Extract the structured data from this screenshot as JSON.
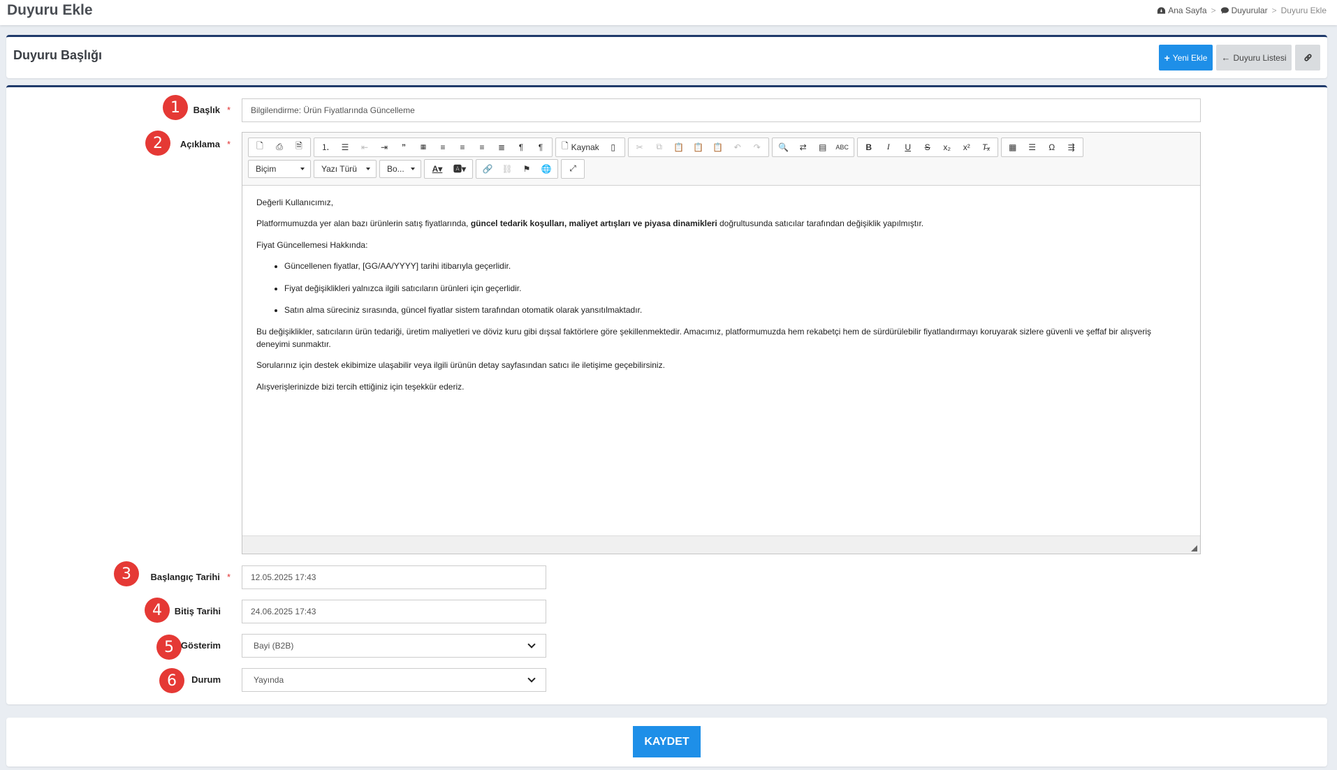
{
  "page": {
    "title": "Duyuru Ekle"
  },
  "breadcrumb": {
    "home": "Ana Sayfa",
    "announcements": "Duyurular",
    "current": "Duyuru Ekle",
    "separator": ">"
  },
  "header": {
    "title": "Duyuru Başlığı",
    "add_new": "Yeni Ekle",
    "list": "Duyuru Listesi"
  },
  "form": {
    "title_label": "Başlık",
    "title_value": "Bilgilendirme: Ürün Fiyatlarında Güncelleme",
    "desc_label": "Açıklama",
    "start_label": "Başlangıç Tarihi",
    "start_value": "12.05.2025 17:43",
    "end_label": "Bitiş Tarihi",
    "end_value": "24.06.2025 17:43",
    "display_label": "Gösterim",
    "display_value": "Bayi (B2B)",
    "status_label": "Durum",
    "status_value": "Yayında",
    "required_mark": "*"
  },
  "markers": [
    "1",
    "2",
    "3",
    "4",
    "5",
    "6"
  ],
  "editor": {
    "source_label": "Kaynak",
    "format_combo": "Biçim",
    "font_combo": "Yazı Türü",
    "size_combo": "Bo...",
    "content": {
      "greeting": "Değerli Kullanıcımız,",
      "p1_start": "Platformumuzda yer alan bazı ürünlerin satış fiyatlarında, ",
      "p1_bold": "güncel tedarik koşulları, maliyet artışları ve piyasa dinamikleri",
      "p1_end": " doğrultusunda satıcılar tarafından değişiklik yapılmıştır.",
      "section_title": "Fiyat Güncellemesi Hakkında:",
      "bullets": [
        "Güncellenen fiyatlar, [GG/AA/YYYY] tarihi itibarıyla geçerlidir.",
        "Fiyat değişiklikleri yalnızca ilgili satıcıların ürünleri için geçerlidir.",
        "Satın alma süreciniz sırasında, güncel fiyatlar sistem tarafından otomatik olarak yansıtılmaktadır."
      ],
      "p2": "Bu değişiklikler, satıcıların ürün tedariği, üretim maliyetleri ve döviz kuru gibi dışsal faktörlere göre şekillenmektedir. Amacımız, platformumuzda hem rekabetçi hem de sürdürülebilir fiyatlandırmayı koruyarak sizlere güvenli ve şeffaf bir alışveriş deneyimi sunmaktır.",
      "p3": "Sorularınız için destek ekibimize ulaşabilir veya ilgili ürünün detay sayfasından satıcı ile iletişime geçebilirsiniz.",
      "p4": "Alışverişlerinizde bizi tercih ettiğiniz için teşekkür ederiz."
    }
  },
  "actions": {
    "save": "KAYDET"
  },
  "colors": {
    "primary": "#1e8fe8",
    "marker": "#e53935",
    "panel_border": "#1f3a6b"
  }
}
